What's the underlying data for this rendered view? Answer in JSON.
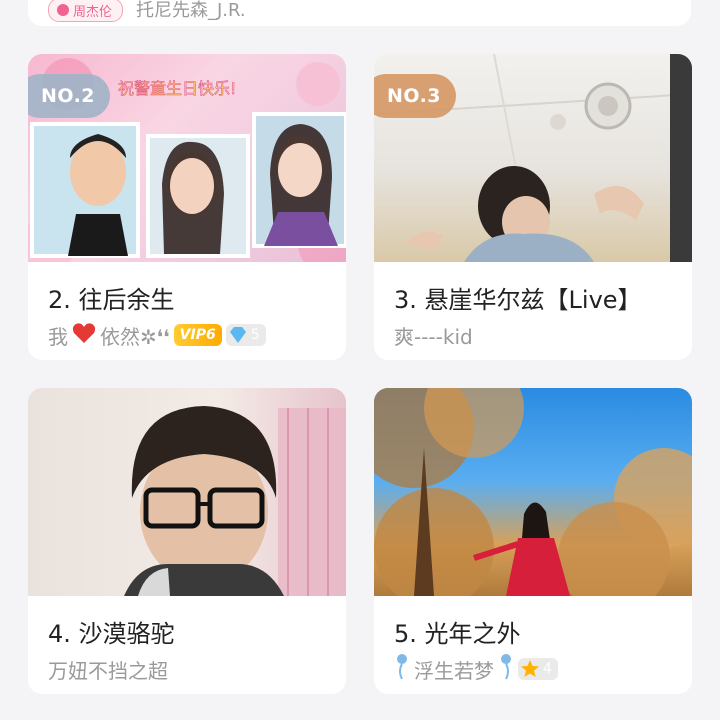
{
  "top_card": {
    "badge": "周杰伦",
    "name": "托尼先森_J.R."
  },
  "cards": [
    {
      "rank": "NO.2",
      "title": "2. 往后余生",
      "user_prefix": "我",
      "user_suffix": "依然✲❛❛",
      "vip": "VIP6",
      "level": "5",
      "image_banner": "祝警童生日快乐!"
    },
    {
      "rank": "NO.3",
      "title": "3. 悬崖华尔兹【Live】",
      "user": "爽----kid"
    },
    {
      "title": "4. 沙漠骆驼",
      "user": "万妞不挡之超"
    },
    {
      "title": "5. 光年之外",
      "user": "浮生若梦",
      "level": "4"
    }
  ],
  "colors": {
    "background": "#f4f4f6",
    "card": "#ffffff",
    "rank2": "#a0b4c8",
    "rank3": "#d69866",
    "vip": "#ffb300"
  }
}
